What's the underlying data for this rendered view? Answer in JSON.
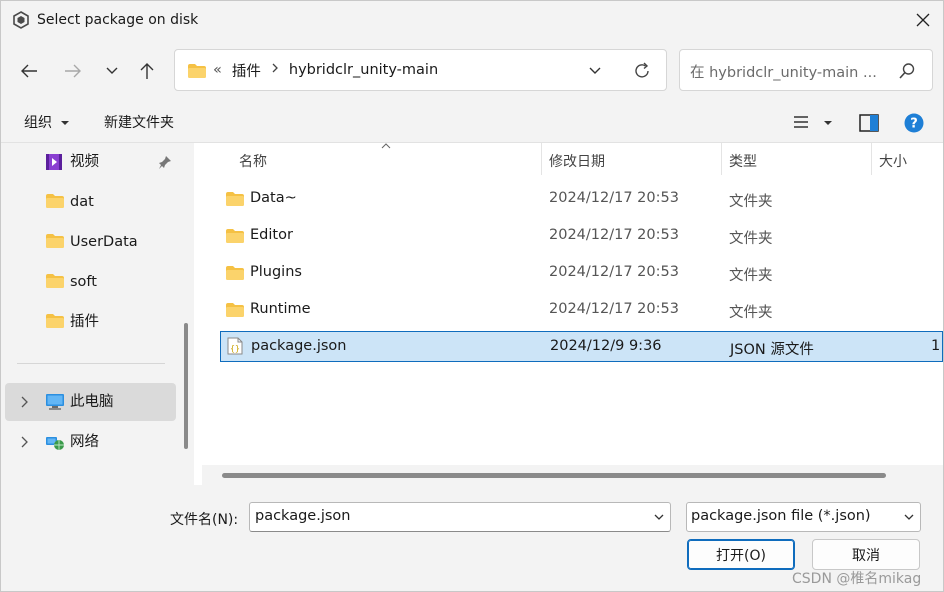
{
  "window": {
    "title": "Select package on disk"
  },
  "address": {
    "overflow": "«",
    "crumbs": [
      "插件",
      "hybridclr_unity-main"
    ]
  },
  "search": {
    "placeholder": "在 hybridclr_unity-main ..."
  },
  "toolbar": {
    "organize": "组织",
    "new_folder": "新建文件夹"
  },
  "sidebar": {
    "items": [
      {
        "label": "视频",
        "icon": "video-icon"
      },
      {
        "label": "dat",
        "icon": "folder-icon"
      },
      {
        "label": "UserData",
        "icon": "folder-icon"
      },
      {
        "label": "soft",
        "icon": "folder-icon"
      },
      {
        "label": "插件",
        "icon": "folder-icon"
      }
    ],
    "computer": "此电脑",
    "network": "网络"
  },
  "columns": {
    "name": "名称",
    "date": "修改日期",
    "type": "类型",
    "size": "大小"
  },
  "files": [
    {
      "name": "Data~",
      "date": "2024/12/17 20:53",
      "type": "文件夹",
      "size": "",
      "icon": "folder-icon"
    },
    {
      "name": "Editor",
      "date": "2024/12/17 20:53",
      "type": "文件夹",
      "size": "",
      "icon": "folder-icon"
    },
    {
      "name": "Plugins",
      "date": "2024/12/17 20:53",
      "type": "文件夹",
      "size": "",
      "icon": "folder-icon"
    },
    {
      "name": "Runtime",
      "date": "2024/12/17 20:53",
      "type": "文件夹",
      "size": "",
      "icon": "folder-icon"
    },
    {
      "name": "package.json",
      "date": "2024/12/9 9:36",
      "type": "JSON 源文件",
      "size": "1",
      "icon": "json-file-icon",
      "selected": true
    }
  ],
  "filename": {
    "label": "文件名(N):",
    "value": "package.json"
  },
  "filetype": {
    "value": "package.json file (*.json)"
  },
  "buttons": {
    "open": "打开(O)",
    "cancel": "取消"
  },
  "watermark": "CSDN @椎名mikag",
  "colors": {
    "accent": "#0f6cbd",
    "selection": "#cce4f7",
    "folder": "#f5c144"
  }
}
